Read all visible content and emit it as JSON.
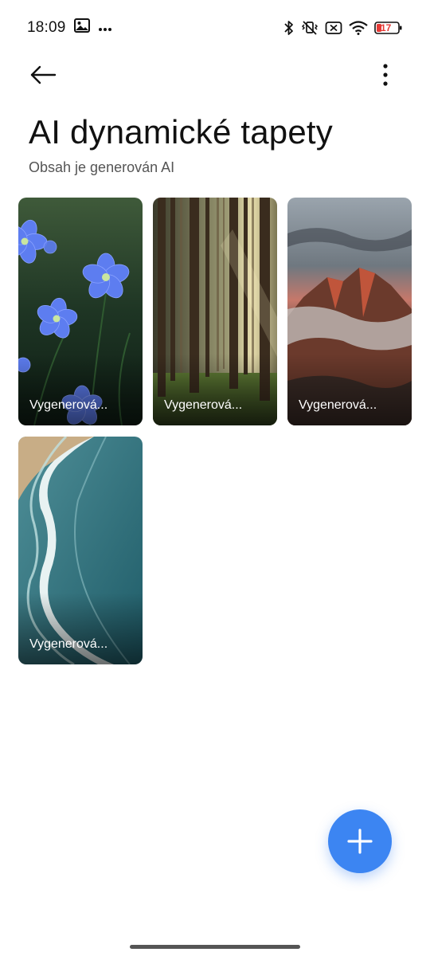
{
  "status_bar": {
    "time": "18:09",
    "left_icons": [
      "image-icon",
      "more-dots-icon"
    ],
    "right_icons": [
      "bluetooth-icon",
      "vibrate-off-icon",
      "no-sim-icon",
      "wifi-icon",
      "battery-icon"
    ],
    "battery_level": "17",
    "battery_color": "#e53935"
  },
  "toolbar": {
    "back_icon": "arrow-left-icon",
    "menu_icon": "more-vertical-icon"
  },
  "header": {
    "title": "AI dynamické tapety",
    "subtitle": "Obsah je generován AI"
  },
  "wallpapers": [
    {
      "label": "Vygenerová...",
      "image": "blue-flowers"
    },
    {
      "label": "Vygenerová...",
      "image": "sunlit-forest"
    },
    {
      "label": "Vygenerová...",
      "image": "mountain-clouds"
    },
    {
      "label": "Vygenerová...",
      "image": "ocean-waves"
    }
  ],
  "fab": {
    "icon": "plus-icon",
    "color": "#3c85f2"
  }
}
